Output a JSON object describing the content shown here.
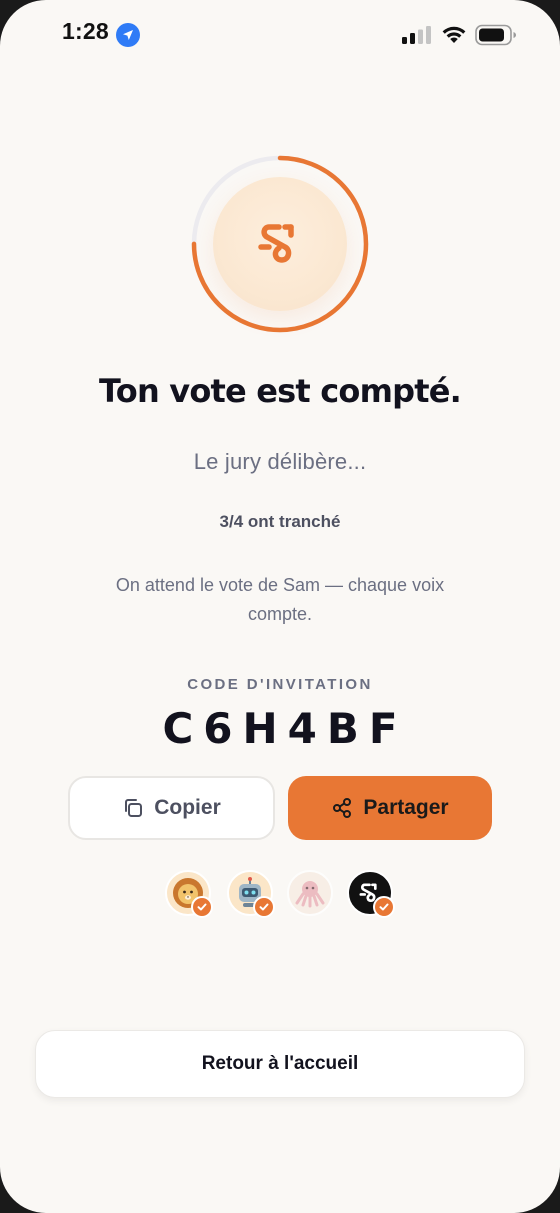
{
  "status_bar": {
    "time": "1:28",
    "icons": [
      "location-arrow-icon",
      "signal-icon",
      "wifi-icon",
      "battery-icon"
    ]
  },
  "hero": {
    "icon": "squiggle-logo-icon",
    "progress_fraction": 0.75,
    "accent_color": "#e87734"
  },
  "title": "Ton vote est compté.",
  "subtitle": "Le jury délibère...",
  "progress_text": "3/4 ont tranché",
  "wait_message": "On attend le vote de Sam — chaque voix compte.",
  "invite": {
    "label": "CODE D'INVITATION",
    "code": "C6H4BF"
  },
  "buttons": {
    "copy_label": "Copier",
    "copy_icon": "copy-icon",
    "share_label": "Partager",
    "share_icon": "share-icon",
    "home_label": "Retour à l'accueil"
  },
  "players": [
    {
      "avatar": "lion",
      "voted": true
    },
    {
      "avatar": "robot",
      "voted": true
    },
    {
      "avatar": "octopus",
      "voted": false
    },
    {
      "avatar": "squiggle",
      "voted": true
    }
  ],
  "colors": {
    "accent": "#e87734",
    "background": "#faf8f5",
    "text_primary": "#12121e",
    "text_secondary": "#6b6f82"
  }
}
